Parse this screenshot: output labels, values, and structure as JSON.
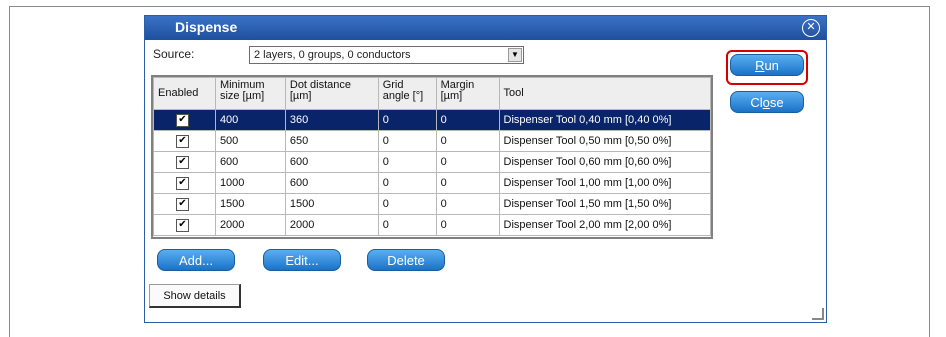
{
  "dialog": {
    "title": "Dispense"
  },
  "source": {
    "label": "Source:",
    "value": "2 layers, 0 groups, 0 conductors"
  },
  "table": {
    "headers": [
      {
        "l1": "Enabled",
        "l2": ""
      },
      {
        "l1": "Minimum",
        "l2": "size [µm]"
      },
      {
        "l1": "Dot distance",
        "l2": "[µm]"
      },
      {
        "l1": "Grid",
        "l2": "angle [°]"
      },
      {
        "l1": "Margin",
        "l2": "[µm]"
      },
      {
        "l1": "Tool",
        "l2": ""
      }
    ],
    "rows": [
      {
        "enabled": "✔",
        "min": "400",
        "dot": "360",
        "angle": "0",
        "margin": "0",
        "tool": "Dispenser Tool 0,40 mm  [0,40  0%]"
      },
      {
        "enabled": "✔",
        "min": "500",
        "dot": "650",
        "angle": "0",
        "margin": "0",
        "tool": "Dispenser Tool 0,50 mm  [0,50  0%]"
      },
      {
        "enabled": "✔",
        "min": "600",
        "dot": "600",
        "angle": "0",
        "margin": "0",
        "tool": "Dispenser Tool 0,60 mm  [0,60  0%]"
      },
      {
        "enabled": "✔",
        "min": "1000",
        "dot": "600",
        "angle": "0",
        "margin": "0",
        "tool": "Dispenser Tool 1,00 mm  [1,00  0%]"
      },
      {
        "enabled": "✔",
        "min": "1500",
        "dot": "1500",
        "angle": "0",
        "margin": "0",
        "tool": "Dispenser Tool 1,50 mm  [1,50  0%]"
      },
      {
        "enabled": "✔",
        "min": "2000",
        "dot": "2000",
        "angle": "0",
        "margin": "0",
        "tool": "Dispenser Tool 2,00 mm  [2,00  0%]"
      }
    ]
  },
  "buttons": {
    "run_pre": "",
    "run_u": "R",
    "run_post": "un",
    "close_pre": "Cl",
    "close_u": "o",
    "close_post": "se",
    "add": "Add...",
    "edit": "Edit...",
    "delete": "Delete",
    "details": "Show details"
  },
  "icons": {
    "close": "close-icon",
    "dropdown": "chevron-down-icon",
    "resize": "resize-grip-icon"
  },
  "colors": {
    "title_bar": "#1f4f9e",
    "selection": "#0a246a",
    "button": "#1a72c8",
    "highlight": "#d40000"
  }
}
